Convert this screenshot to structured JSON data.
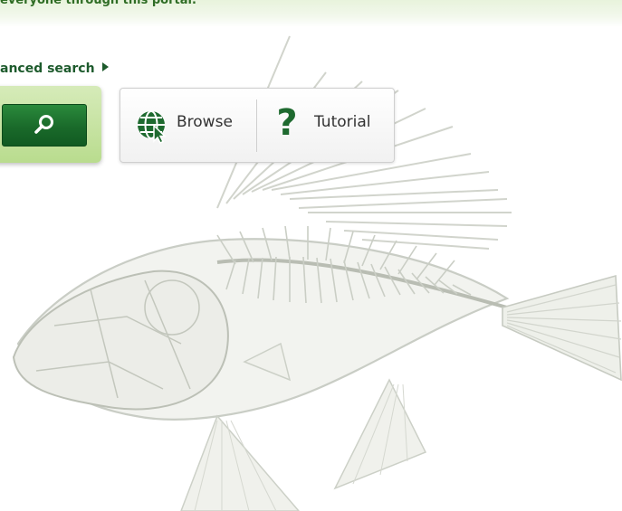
{
  "header": {
    "intro_text": "everyone through this portal."
  },
  "search": {
    "advanced_label": "anced search",
    "button_icon": "magnifier-icon"
  },
  "nav": {
    "browse_label": "Browse",
    "browse_icon": "globe-cursor-icon",
    "tutorial_label": "Tutorial",
    "tutorial_icon": "question-mark-icon"
  },
  "colors": {
    "accent_green": "#1e6a2f",
    "panel_green": "#c3e19e",
    "text_dark_green": "#1e5b2d"
  }
}
